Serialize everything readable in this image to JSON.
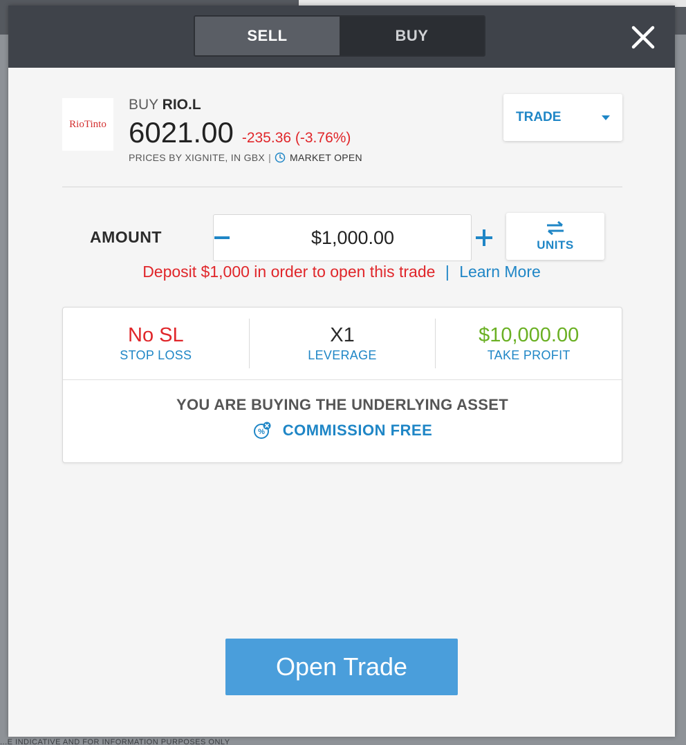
{
  "background": {
    "disclaimer": "...E INDICATIVE AND FOR INFORMATION PURPOSES ONLY"
  },
  "header": {
    "sell_label": "SELL",
    "buy_label": "BUY",
    "selected": "SELL"
  },
  "instrument": {
    "logo_text": "RioTinto",
    "action": "BUY",
    "ticker": "RIO.L",
    "price": "6021.00",
    "change": "-235.36 (-3.76%)",
    "prices_by": "PRICES BY XIGNITE, IN GBX",
    "separator": "|",
    "market_status": "MARKET OPEN"
  },
  "order_type": {
    "label": "TRADE"
  },
  "amount": {
    "label": "AMOUNT",
    "value": "$1,000.00",
    "units_label": "UNITS"
  },
  "deposit": {
    "message": "Deposit $1,000 in order to open this trade",
    "separator": "|",
    "link": "Learn More"
  },
  "stats": [
    {
      "value": "No SL",
      "label": "STOP LOSS"
    },
    {
      "value": "X1",
      "label": "LEVERAGE"
    },
    {
      "value": "$10,000.00",
      "label": "TAKE PROFIT"
    }
  ],
  "notice": {
    "text": "YOU ARE BUYING THE UNDERLYING ASSET",
    "commission": "COMMISSION FREE"
  },
  "submit": {
    "label": "Open Trade"
  },
  "colors": {
    "accent": "#1f86c6",
    "negative": "#e0262a",
    "positive": "#6ab023",
    "button": "#4a9edb",
    "header": "#3f434a"
  }
}
